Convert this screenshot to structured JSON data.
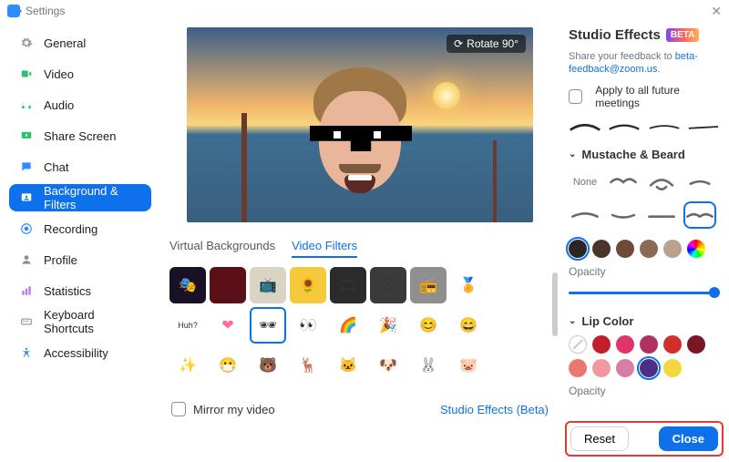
{
  "window": {
    "title": "Settings"
  },
  "sidebar": {
    "items": [
      {
        "label": "General",
        "icon": "gear"
      },
      {
        "label": "Video",
        "icon": "video"
      },
      {
        "label": "Audio",
        "icon": "audio"
      },
      {
        "label": "Share Screen",
        "icon": "share"
      },
      {
        "label": "Chat",
        "icon": "chat"
      },
      {
        "label": "Background & Filters",
        "icon": "background",
        "active": true
      },
      {
        "label": "Recording",
        "icon": "record"
      },
      {
        "label": "Profile",
        "icon": "profile"
      },
      {
        "label": "Statistics",
        "icon": "stats"
      },
      {
        "label": "Keyboard Shortcuts",
        "icon": "keyboard"
      },
      {
        "label": "Accessibility",
        "icon": "accessibility"
      }
    ]
  },
  "preview": {
    "rotate_label": "Rotate 90°"
  },
  "tabs": {
    "items": [
      {
        "label": "Virtual Backgrounds",
        "active": false
      },
      {
        "label": "Video Filters",
        "active": true
      }
    ]
  },
  "filters": {
    "selected_index": 11,
    "items": [
      {
        "name": "theater",
        "bg": "#1a1126",
        "glyph": "🎭"
      },
      {
        "name": "curtain",
        "bg": "#5b0f17",
        "glyph": ""
      },
      {
        "name": "tv",
        "bg": "#d9d4c4",
        "glyph": "📺"
      },
      {
        "name": "sunflower",
        "bg": "#f4c93a",
        "glyph": "🌻"
      },
      {
        "name": "film",
        "bg": "#2b2b2b",
        "glyph": "🎞"
      },
      {
        "name": "focus",
        "bg": "#3a3a3a",
        "glyph": "⛶"
      },
      {
        "name": "microwave",
        "bg": "#8f8f8f",
        "glyph": "📻"
      },
      {
        "name": "ribbon",
        "bg": "#fff",
        "glyph": "🏅"
      },
      {
        "name": "empty1",
        "bg": "#fff",
        "glyph": ""
      },
      {
        "name": "huh",
        "bg": "#fff",
        "glyph": "Huh?"
      },
      {
        "name": "heart",
        "bg": "#fff",
        "glyph": "❤"
      },
      {
        "name": "deal-glasses",
        "bg": "#fff",
        "glyph": "🕶"
      },
      {
        "name": "eyes",
        "bg": "#fff",
        "glyph": "👀"
      },
      {
        "name": "rainbow",
        "bg": "#fff",
        "glyph": "🌈"
      },
      {
        "name": "party",
        "bg": "#fff",
        "glyph": "🎉"
      },
      {
        "name": "smile",
        "bg": "#fff",
        "glyph": "😊"
      },
      {
        "name": "grin",
        "bg": "#fff",
        "glyph": "😄"
      },
      {
        "name": "empty2",
        "bg": "#fff",
        "glyph": ""
      },
      {
        "name": "stars",
        "bg": "#fff",
        "glyph": "✨"
      },
      {
        "name": "mask",
        "bg": "#fff",
        "glyph": "😷"
      },
      {
        "name": "bear",
        "bg": "#fff",
        "glyph": "🐻"
      },
      {
        "name": "deer",
        "bg": "#fff",
        "glyph": "🦌"
      },
      {
        "name": "cat",
        "bg": "#fff",
        "glyph": "🐱"
      },
      {
        "name": "dog",
        "bg": "#fff",
        "glyph": "🐶"
      },
      {
        "name": "rabbit",
        "bg": "#fff",
        "glyph": "🐰"
      },
      {
        "name": "pig",
        "bg": "#fff",
        "glyph": "🐷"
      },
      {
        "name": "empty3",
        "bg": "#fff",
        "glyph": ""
      }
    ]
  },
  "mirror": {
    "label": "Mirror my video",
    "checked": false
  },
  "studio_link": "Studio Effects (Beta)",
  "panel": {
    "title": "Studio Effects",
    "badge": "BETA",
    "feedback_prefix": "Share your feedback to ",
    "feedback_link": "beta-feedback@zoom.us",
    "feedback_suffix": ".",
    "apply_label": "Apply to all future meetings",
    "mustache": {
      "title": "Mustache & Beard",
      "none_label": "None",
      "selected_index": 7,
      "colors": [
        "#2b2622",
        "#4a352a",
        "#6e4b36",
        "#8a6a53",
        "#b9a18d",
        "rainbow"
      ],
      "selected_color": 0,
      "opacity_label": "Opacity",
      "opacity_value": 100
    },
    "lip": {
      "title": "Lip Color",
      "colors": [
        "none",
        "#c21f2b",
        "#e0356b",
        "#b03060",
        "#d12f2f",
        "#7a1625",
        "#e9786f",
        "#f09aa0",
        "#d77ea2",
        "#4a2f82",
        "#f4d63f"
      ],
      "selected_index": 9,
      "opacity_label": "Opacity"
    },
    "reset_label": "Reset",
    "close_label": "Close"
  },
  "icon_colors": {
    "gear": "#9aa0a6",
    "video": "#29c26a",
    "audio": "#1fb6a6",
    "share": "#29c26a",
    "chat": "#2d8cff",
    "background": "#ffffff",
    "record": "#2d8cff",
    "profile": "#8e8e93",
    "stats": "#b977e6",
    "keyboard": "#6e7680",
    "accessibility": "#2d8cff"
  }
}
